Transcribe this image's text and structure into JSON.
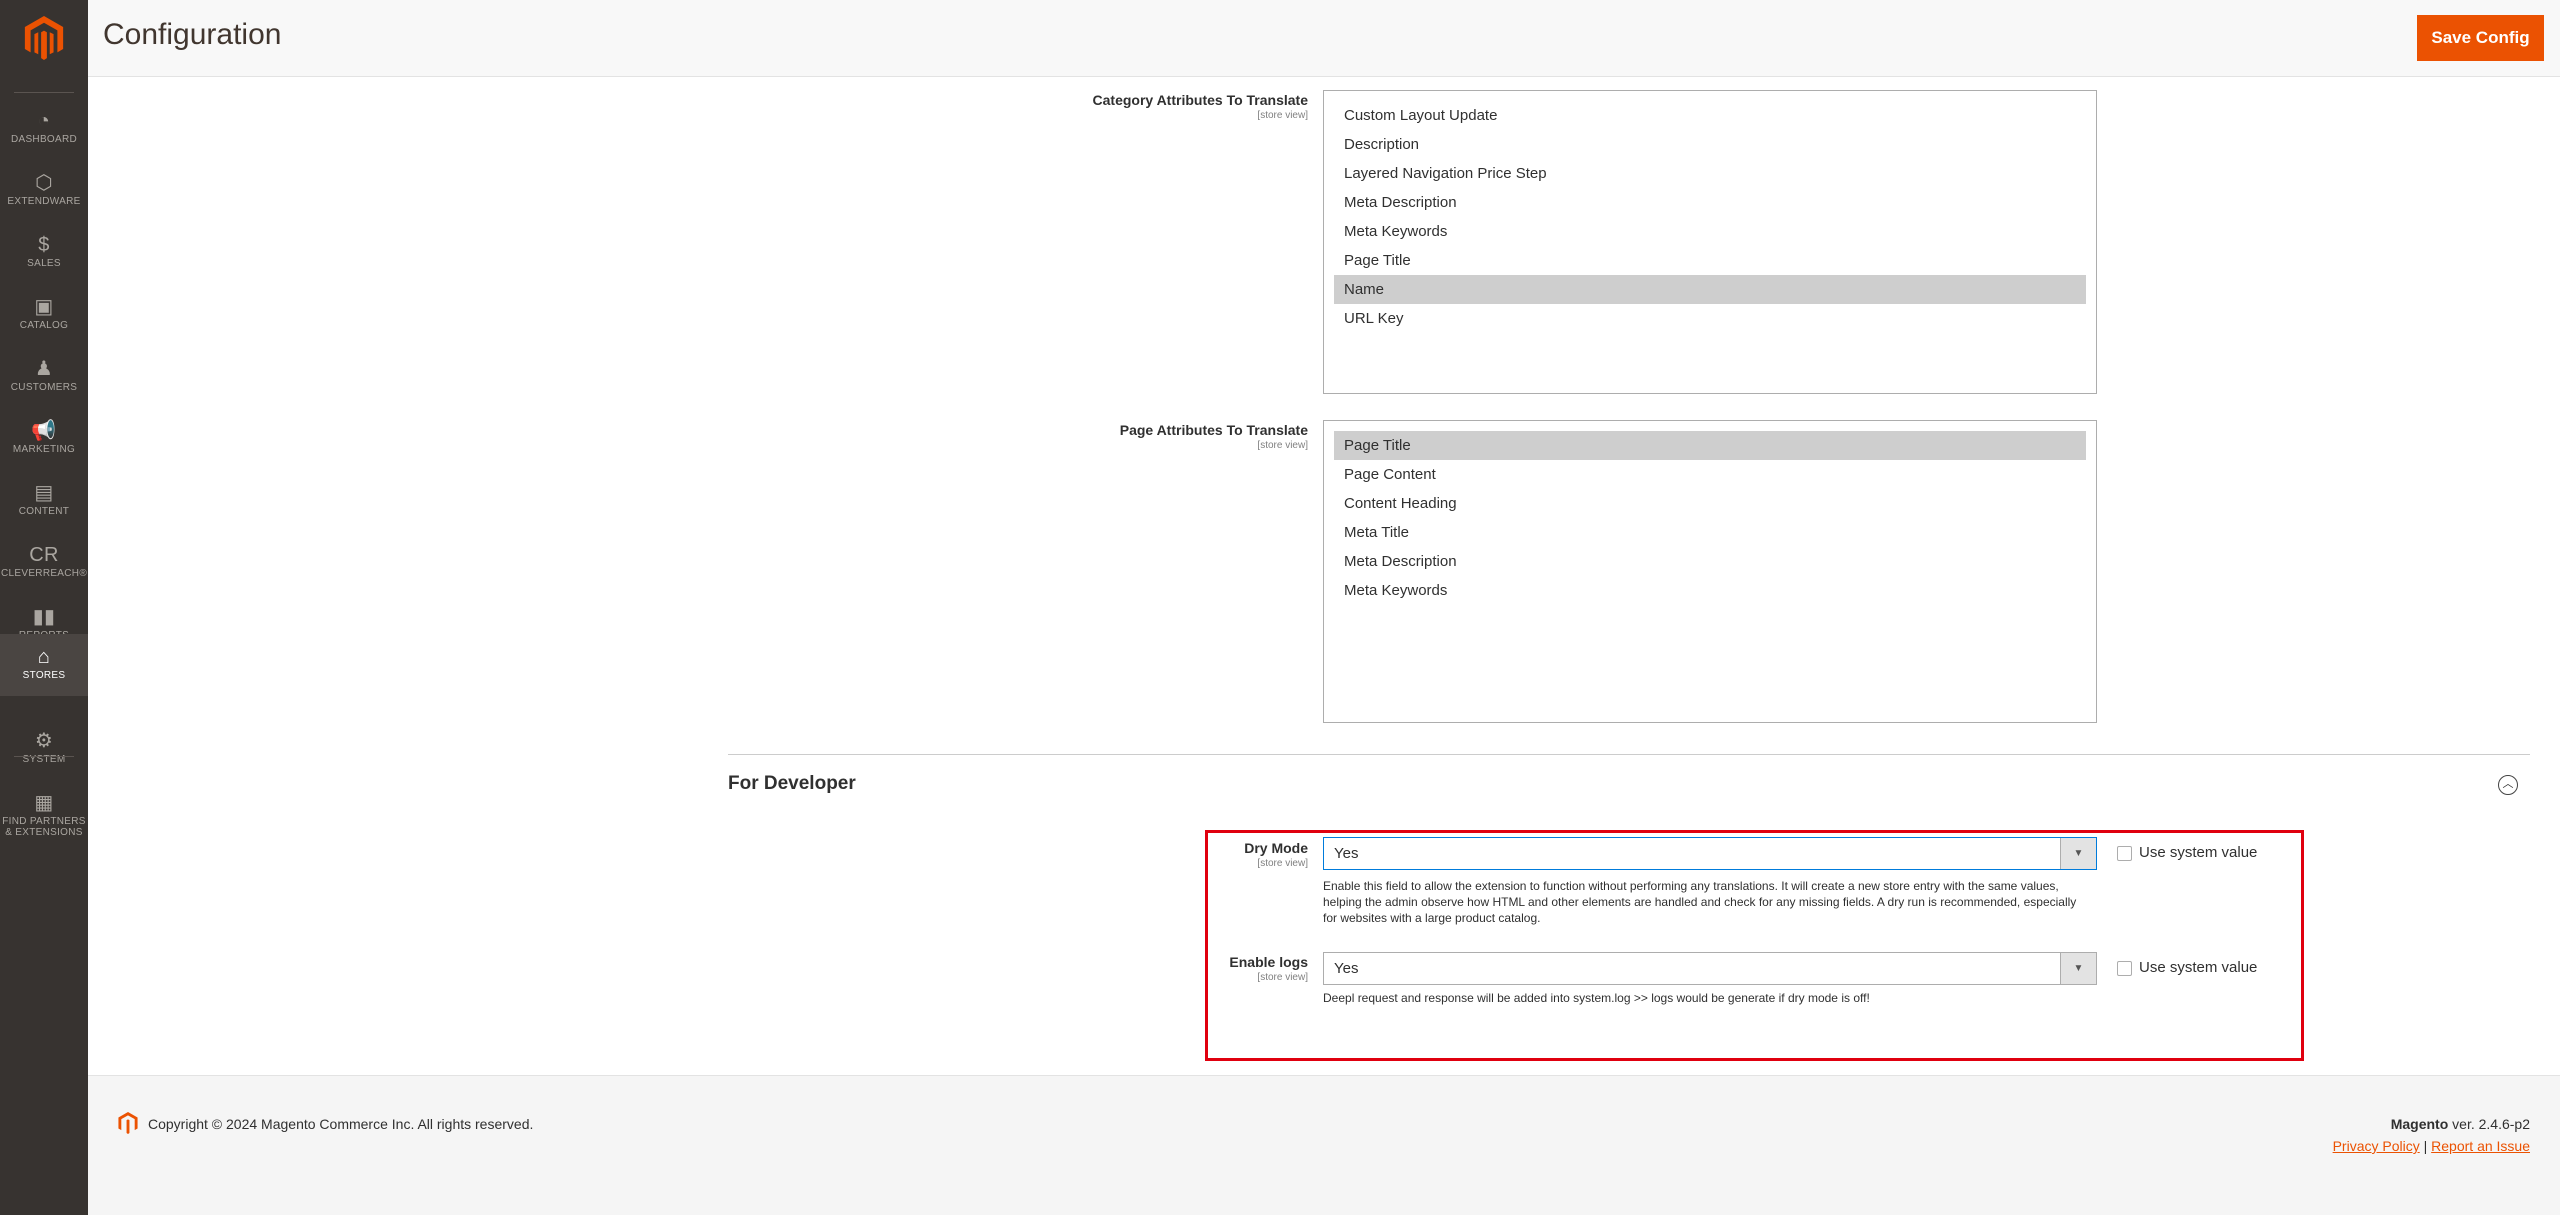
{
  "sidebar": {
    "items": [
      {
        "label": "DASHBOARD",
        "icon": "dashboard-icon",
        "glyph": "◔"
      },
      {
        "label": "EXTENDWARE",
        "icon": "hexagon-icon",
        "glyph": "⬡"
      },
      {
        "label": "SALES",
        "icon": "dollar-icon",
        "glyph": "$"
      },
      {
        "label": "CATALOG",
        "icon": "box-icon",
        "glyph": "▣"
      },
      {
        "label": "CUSTOMERS",
        "icon": "person-icon",
        "glyph": "♟"
      },
      {
        "label": "MARKETING",
        "icon": "megaphone-icon",
        "glyph": "📢"
      },
      {
        "label": "CONTENT",
        "icon": "layout-icon",
        "glyph": "▤"
      },
      {
        "label": "CLEVERREACH®",
        "icon": "cleverreach-icon",
        "glyph": "CR"
      },
      {
        "label": "REPORTS",
        "icon": "bar-chart-icon",
        "glyph": "▮▮"
      },
      {
        "label": "STORES",
        "icon": "store-icon",
        "glyph": "⌂"
      },
      {
        "label": "SYSTEM",
        "icon": "gear-icon",
        "glyph": "⚙"
      },
      {
        "label": "FIND PARTNERS & EXTENSIONS",
        "icon": "blocks-icon",
        "glyph": "▦"
      }
    ],
    "active": "STORES"
  },
  "header": {
    "title": "Configuration",
    "save_label": "Save Config"
  },
  "category": {
    "label": "Category Attributes To Translate",
    "scope": "[store view]",
    "options": [
      "Custom Layout Update",
      "Description",
      "Layered Navigation Price Step",
      "Meta Description",
      "Meta Keywords",
      "Page Title",
      "Name",
      "URL Key"
    ],
    "selected": [
      "Name"
    ]
  },
  "page": {
    "label": "Page Attributes To Translate",
    "scope": "[store view]",
    "options": [
      "Page Title",
      "Page Content",
      "Content Heading",
      "Meta Title",
      "Meta Description",
      "Meta Keywords"
    ],
    "selected": [
      "Page Title"
    ]
  },
  "developer": {
    "title": "For Developer",
    "dry_mode": {
      "label": "Dry Mode",
      "scope": "[store view]",
      "value": "Yes",
      "use_system": "Use system value",
      "help": "Enable this field to allow the extension to function without performing any translations. It will create a new store entry with the same values, helping the admin observe how HTML and other elements are handled and check for any missing fields. A dry run is recommended, especially for websites with a large product catalog."
    },
    "logs": {
      "label": "Enable logs",
      "scope": "[store view]",
      "value": "Yes",
      "use_system": "Use system value",
      "help": "Deepl request and response will be added into system.log >> logs would be generate if dry mode is off!"
    }
  },
  "footer": {
    "copyright": "Copyright © 2024 Magento Commerce Inc. All rights reserved.",
    "brand": "Magento",
    "version": " ver. 2.4.6-p2",
    "privacy": "Privacy Policy",
    "separator": " | ",
    "report": "Report an Issue"
  },
  "colors": {
    "accent": "#eb5202",
    "sidebar": "#373330",
    "highlight": "#e0000f"
  }
}
